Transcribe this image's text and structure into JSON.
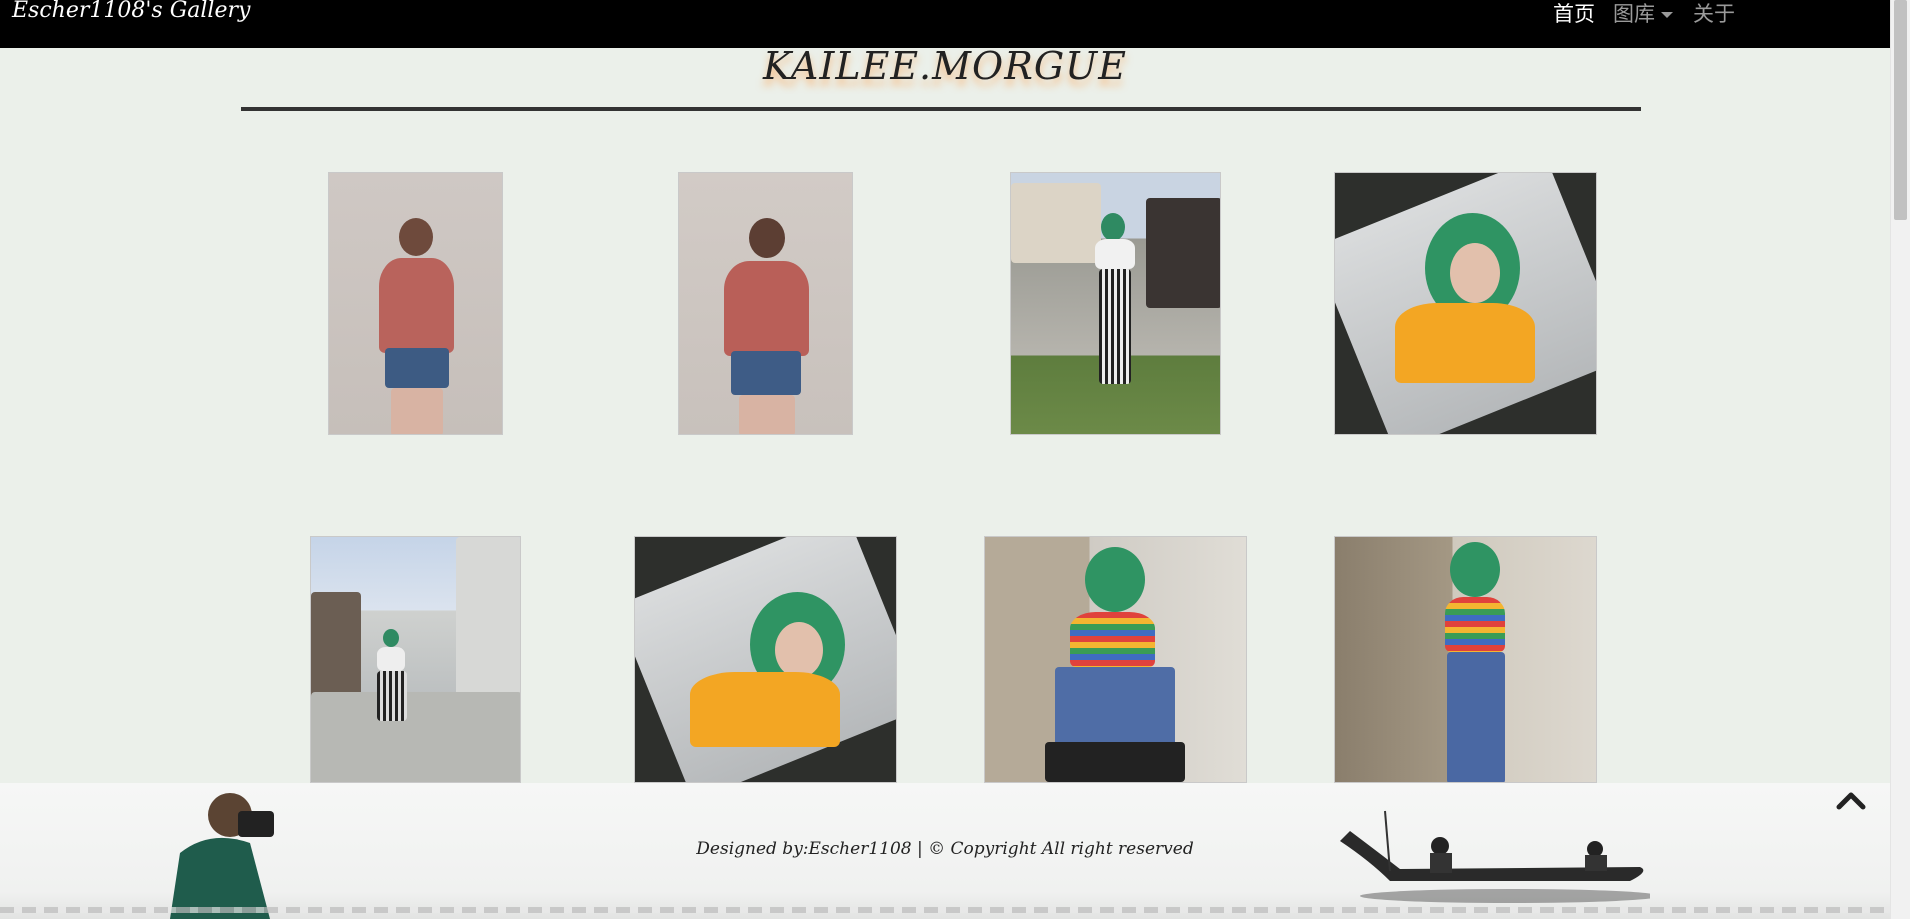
{
  "navbar": {
    "brand": "Escher1108's Gallery",
    "items": [
      {
        "label": "首页",
        "active": true
      },
      {
        "label": "图库",
        "has_dropdown": true
      },
      {
        "label": "关于"
      }
    ]
  },
  "page": {
    "title": "KAILEE.MORGUE"
  },
  "gallery": {
    "photos": [
      {
        "subject": "woman-red-tee-arms-up",
        "icon": "photo-thumbnail"
      },
      {
        "subject": "woman-red-tee-pigtails",
        "icon": "photo-thumbnail"
      },
      {
        "subject": "green-hair-plaid-pants-yard",
        "icon": "photo-thumbnail"
      },
      {
        "subject": "green-hair-yellow-top-selfie",
        "icon": "photo-thumbnail"
      },
      {
        "subject": "green-hair-sitting-wall",
        "icon": "photo-thumbnail"
      },
      {
        "subject": "green-hair-yellow-top-tilted",
        "icon": "photo-thumbnail"
      },
      {
        "subject": "green-hair-rainbow-top-crouch",
        "icon": "photo-thumbnail"
      },
      {
        "subject": "green-hair-rainbow-top-alley",
        "icon": "photo-thumbnail"
      }
    ]
  },
  "footer": {
    "credit": "Designed by:Escher1108 | © Copyright All right reserved"
  },
  "controls": {
    "back_to_top_icon": "chevron-up-icon"
  }
}
